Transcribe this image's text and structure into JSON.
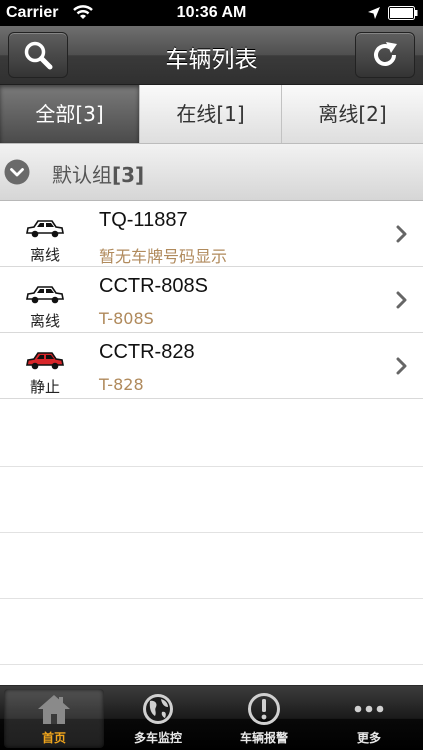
{
  "status_bar": {
    "carrier": "Carrier",
    "time": "10:36 AM"
  },
  "nav": {
    "title": "车辆列表",
    "left_icon": "search-icon",
    "right_icon": "refresh-icon"
  },
  "segments": [
    {
      "label": "全部[3]",
      "active": true
    },
    {
      "label": "在线[1]",
      "active": false
    },
    {
      "label": "离线[2]",
      "active": false
    }
  ],
  "group": {
    "name": "默认组",
    "count": "[3]"
  },
  "vehicles": [
    {
      "plate": "TQ-11887",
      "sub": "暂无车牌号码显示",
      "status": "离线",
      "car_color": "#ffffff"
    },
    {
      "plate": "CCTR-808S",
      "sub": "T-808S",
      "status": "离线",
      "car_color": "#ffffff"
    },
    {
      "plate": "CCTR-828",
      "sub": "T-828",
      "status": "静止",
      "car_color": "#d8262a"
    }
  ],
  "tabs": [
    {
      "label": "首页",
      "icon": "home-icon",
      "active": true
    },
    {
      "label": "多车监控",
      "icon": "globe-icon",
      "active": false
    },
    {
      "label": "车辆报警",
      "icon": "alert-icon",
      "active": false
    },
    {
      "label": "更多",
      "icon": "more-icon",
      "active": false
    }
  ],
  "colors": {
    "accent_tab": "#f0a51c",
    "subtext": "#b08a5c"
  }
}
